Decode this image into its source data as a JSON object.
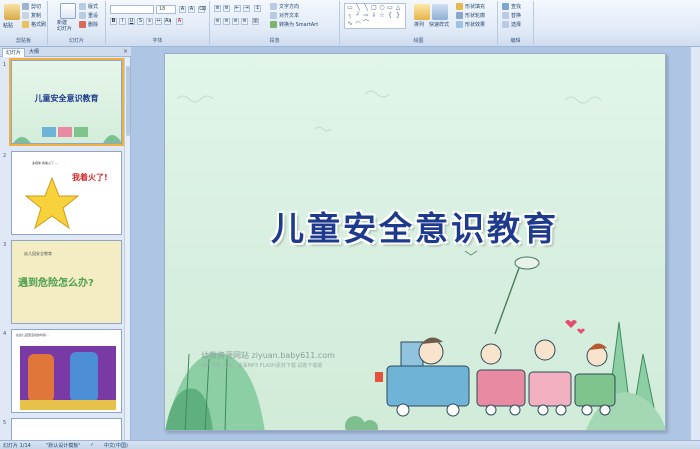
{
  "ribbon": {
    "clipboard": {
      "paste": "粘贴",
      "cut": "剪切",
      "copy": "复制",
      "format_painter": "格式刷",
      "label": "剪贴板"
    },
    "slides": {
      "new_slide": "新建\n幻灯片",
      "layout": "版式",
      "reset": "重设",
      "delete": "删除",
      "label": "幻灯片"
    },
    "font": {
      "name": "",
      "size": "18",
      "label": "字体"
    },
    "paragraph": {
      "text_direction": "文字方向",
      "align_text": "对齐文本",
      "smartart": "转换为 SmartArt",
      "label": "段落"
    },
    "drawing": {
      "arrange": "排列",
      "quick_styles": "快速样式",
      "shape_fill": "形状填充",
      "shape_outline": "形状轮廓",
      "shape_effects": "形状效果",
      "label": "绘图"
    },
    "editing": {
      "find": "查找",
      "replace": "替换",
      "select": "选择",
      "label": "编辑"
    }
  },
  "pane": {
    "tabs": [
      "幻灯片",
      "大纲"
    ],
    "close": "×",
    "thumbnails": [
      {
        "num": "1",
        "title": "儿童安全意识教育"
      },
      {
        "num": "2",
        "caption": "我着火了!",
        "small": "多媒体·我着火了·..."
      },
      {
        "num": "3",
        "title": "遇到危险怎么办?",
        "small": "幼儿园安全教育"
      },
      {
        "num": "4",
        "small": "在幼儿园里活动的时候..."
      },
      {
        "num": "5"
      }
    ]
  },
  "slide": {
    "title": "儿童安全意识教育",
    "watermark": "幼教资源网站  ziyuan.baby611.com",
    "watermark_sub": "课件下载  儿歌、故事MP3  FLASH素材下载  试卷下载版"
  },
  "status": {
    "slide_pos": "幻灯片 1/14",
    "theme": "\"默认设计模板\"",
    "language": "中文(中国)"
  },
  "colors": {
    "title": "#1d3a8c",
    "slide_bg": "#d6eedf",
    "selection": "#f0b040"
  }
}
